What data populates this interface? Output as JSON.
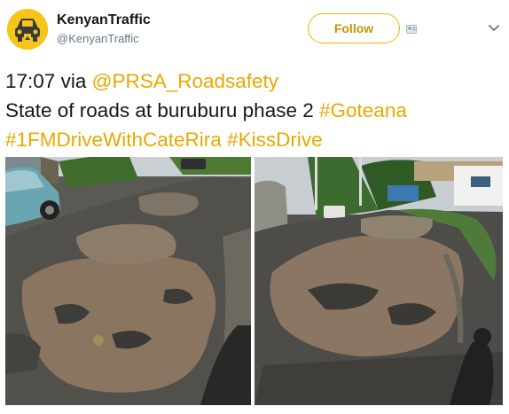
{
  "account": {
    "display_name": "KenyanTraffic",
    "handle": "@KenyanTraffic",
    "avatar_icon": "car-front-icon",
    "brand_color": "#f5c518"
  },
  "header": {
    "follow_label": "Follow",
    "follow_icon": "person-card-icon",
    "menu_icon": "chevron-down-icon"
  },
  "tweet": {
    "time": "17:07",
    "via": "via",
    "via_mention": "@PRSA_Roadsafety",
    "body": "State of roads at buruburu phase 2",
    "hashtags": [
      "#Goteana",
      "#1FMDriveWithCateRira",
      "#KissDrive"
    ],
    "accent_color": "#e8a800"
  },
  "media": [
    {
      "description_icon": "photo-potholed-road-left"
    },
    {
      "description_icon": "photo-potholed-road-right"
    }
  ]
}
